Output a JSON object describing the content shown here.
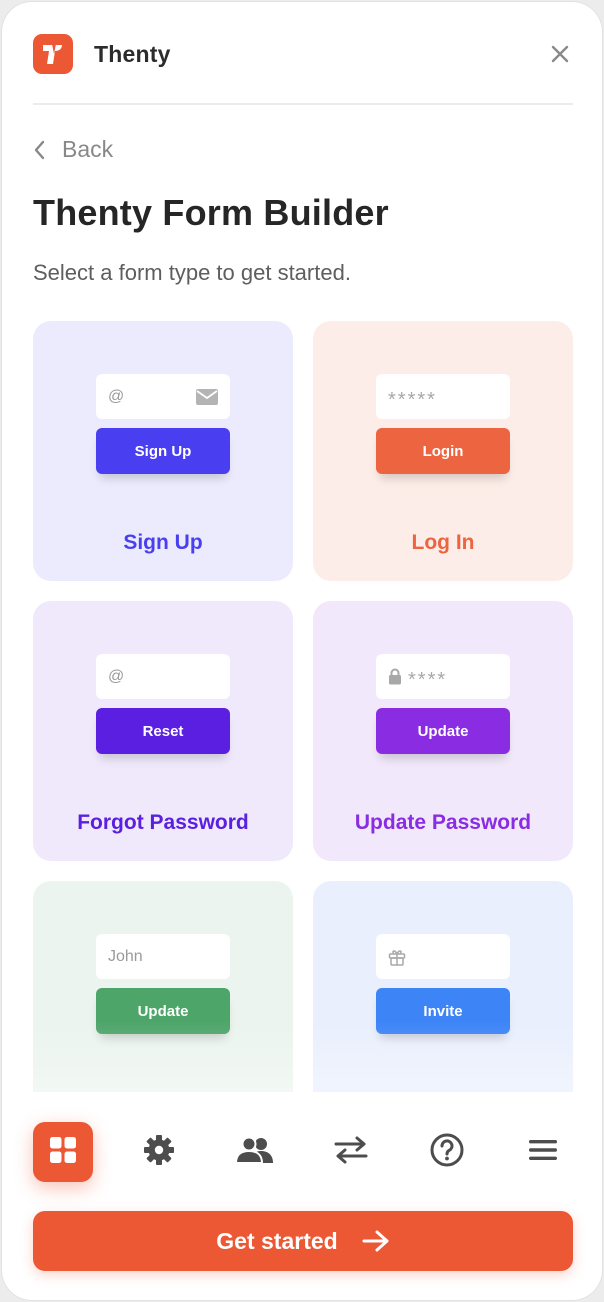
{
  "header": {
    "app_title": "Thenty",
    "logo_icon": "thenty-logo",
    "close_icon": "close-icon",
    "brand_color": "#ec5734"
  },
  "back": {
    "label": "Back",
    "icon": "chevron-left-icon"
  },
  "page": {
    "title": "Thenty Form Builder",
    "subtitle": "Select a form type to get started."
  },
  "cards": [
    {
      "label": "Sign Up",
      "input_prefix": "@",
      "input_icon": "envelope-icon",
      "button": "Sign Up",
      "bg": "#ebebfd",
      "accent": "#4a3ff0"
    },
    {
      "label": "Log In",
      "input_text": "*****",
      "button": "Login",
      "bg": "#fdede8",
      "accent": "#ec6440"
    },
    {
      "label": "Forgot Password",
      "input_prefix": "@",
      "button": "Reset",
      "bg": "#efe9fb",
      "accent": "#5a1fe0"
    },
    {
      "label": "Update Password",
      "input_icon": "lock-icon",
      "input_text": "****",
      "button": "Update",
      "bg": "#f2e8fb",
      "accent": "#8a2de2"
    },
    {
      "input_text": "John",
      "button": "Update",
      "bg": "#ebf4ee",
      "accent": "#4ea56a"
    },
    {
      "input_icon": "gift-icon",
      "button": "Invite",
      "bg": "#e9effd",
      "accent": "#3d84f7"
    }
  ],
  "nav": [
    {
      "name": "grid-icon",
      "active": true
    },
    {
      "name": "gear-icon",
      "active": false
    },
    {
      "name": "users-icon",
      "active": false
    },
    {
      "name": "swap-arrows-icon",
      "active": false
    },
    {
      "name": "help-circle-icon",
      "active": false
    },
    {
      "name": "menu-icon",
      "active": false
    }
  ],
  "cta": {
    "label": "Get started",
    "icon": "arrow-right-icon"
  }
}
